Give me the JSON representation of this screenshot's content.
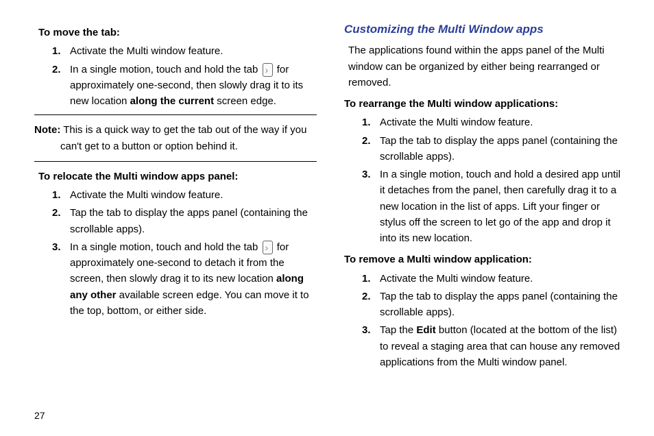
{
  "left": {
    "move_tab_heading": "To move the tab:",
    "move_tab_steps": {
      "s1": "Activate the Multi window feature.",
      "s2a": "In a single motion, touch and hold the tab ",
      "s2b": " for approximately one-second, then slowly drag it to its new location ",
      "s2_bold": "along the current",
      "s2c": " screen edge."
    },
    "note_label": "Note:",
    "note_text": " This is a quick way to get the tab out of the way if you can't get to a button or option behind it.",
    "relocate_heading": "To relocate the Multi window apps panel:",
    "relocate_steps": {
      "s1": "Activate the Multi window feature.",
      "s2": "Tap the tab to display the apps panel (containing the scrollable apps).",
      "s3a": "In a single motion, touch and hold the tab ",
      "s3b": " for approximately one-second to detach it from the screen, then slowly drag it to its new location ",
      "s3_bold": "along any other",
      "s3c": " available screen edge. You can move it to the top, bottom, or either side."
    }
  },
  "right": {
    "title": "Customizing the Multi Window apps",
    "intro": "The applications found within the apps panel of the Multi window can be organized by either being rearranged or removed.",
    "rearrange_heading": "To rearrange the Multi window applications:",
    "rearrange_steps": {
      "s1": "Activate the Multi window feature.",
      "s2": "Tap the tab to display the apps panel (containing the scrollable apps).",
      "s3": "In a single motion, touch and hold a desired app until it detaches from the panel, then carefully drag it to a new location in the list of apps. Lift your finger or stylus off the screen to let go of the app and drop it into its new location."
    },
    "remove_heading": "To remove a Multi window application:",
    "remove_steps": {
      "s1": "Activate the Multi window feature.",
      "s2": "Tap the tab to display the apps panel (containing the scrollable apps).",
      "s3a": "Tap the ",
      "s3_bold": "Edit",
      "s3b": " button (located at the bottom of the list) to reveal a staging area that can house any removed applications from the Multi window panel."
    }
  },
  "page_number": "27"
}
